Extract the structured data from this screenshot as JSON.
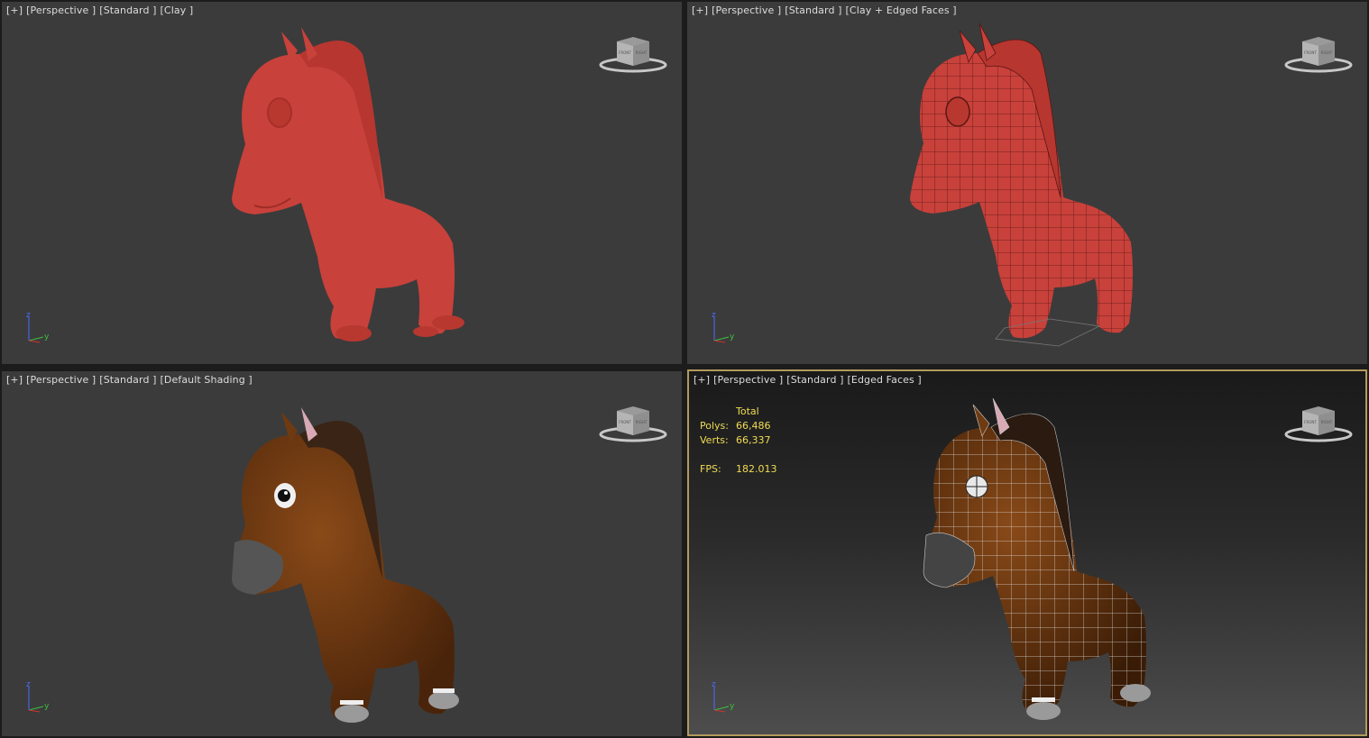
{
  "viewports": [
    {
      "id": "tl",
      "labels": {
        "plus": "[+]",
        "view": "[Perspective ]",
        "preset": "[Standard ]",
        "shading": "[Clay ]"
      }
    },
    {
      "id": "tr",
      "labels": {
        "plus": "[+]",
        "view": "[Perspective ]",
        "preset": "[Standard ]",
        "shading": "[Clay + Edged Faces ]"
      }
    },
    {
      "id": "bl",
      "labels": {
        "plus": "[+]",
        "view": "[Perspective ]",
        "preset": "[Standard ]",
        "shading": "[Default Shading ]"
      }
    },
    {
      "id": "br",
      "labels": {
        "plus": "[+]",
        "view": "[Perspective ]",
        "preset": "[Standard ]",
        "shading": "[Edged Faces ]"
      }
    }
  ],
  "stats": {
    "header": "Total",
    "polys_label": "Polys:",
    "polys": "66,486",
    "verts_label": "Verts:",
    "verts": "66,337",
    "fps_label": "FPS:",
    "fps": "182.013"
  },
  "viewcube": {
    "front": "FRONT",
    "right": "RIGHT"
  },
  "axis": {
    "z": "z",
    "y": "y"
  },
  "colors": {
    "viewport_bg": "#3b3b3b",
    "clay": "#c8413b",
    "horse_brown": "#6e3a12",
    "mane": "#3a2416",
    "active_border": "#b39a5c",
    "stats_text": "#f0dc55"
  }
}
